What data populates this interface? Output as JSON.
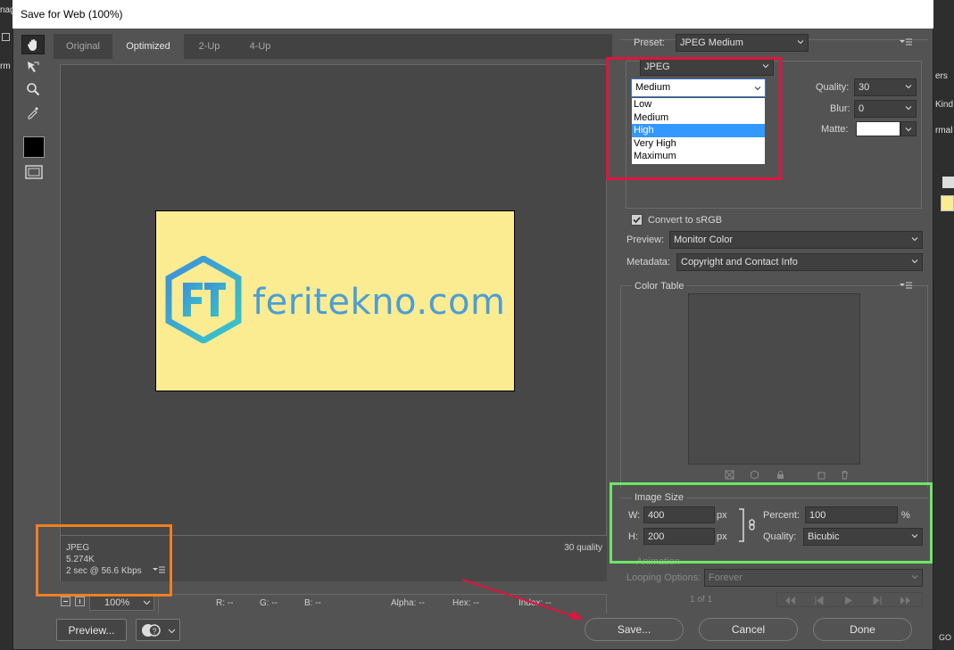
{
  "app": {
    "left_fragments": [
      "nag",
      "rm"
    ],
    "right_fragments": [
      "ers",
      "Kind",
      "rmal",
      "GO"
    ]
  },
  "dialog": {
    "title": "Save for Web (100%)"
  },
  "tabs": [
    "Original",
    "Optimized",
    "2-Up",
    "4-Up"
  ],
  "image": {
    "logo_text": "feritekno.com",
    "logo_mark": "FT"
  },
  "info": {
    "format": "JPEG",
    "size": "5.274K",
    "download": "2 sec @ 56.6 Kbps",
    "quality_note": "30 quality"
  },
  "status": {
    "zoom": "100%",
    "r": "R: --",
    "g": "G: --",
    "b": "B: --",
    "alpha": "Alpha: --",
    "hex": "Hex: --",
    "index": "Index: --"
  },
  "buttons": {
    "preview": "Preview...",
    "save": "Save...",
    "cancel": "Cancel",
    "done": "Done"
  },
  "settings": {
    "preset_label": "Preset:",
    "preset_value": "JPEG Medium",
    "format_value": "JPEG",
    "quality_level": "Medium",
    "quality_options": [
      "Low",
      "Medium",
      "High",
      "Very High",
      "Maximum"
    ],
    "highlighted_option": "High",
    "quality_label": "Quality:",
    "quality_value": "30",
    "blur_label": "Blur:",
    "blur_value": "0",
    "matte_label": "Matte:",
    "convert_label": "Convert to sRGB",
    "preview_label": "Preview:",
    "preview_value": "Monitor Color",
    "metadata_label": "Metadata:",
    "metadata_value": "Copyright and Contact Info"
  },
  "color_table": {
    "title": "Color Table"
  },
  "image_size": {
    "title": "Image Size",
    "w_label": "W:",
    "w_value": "400",
    "h_label": "H:",
    "h_value": "200",
    "unit": "px",
    "percent_label": "Percent:",
    "percent_value": "100",
    "percent_unit": "%",
    "quality_label": "Quality:",
    "quality_value": "Bicubic"
  },
  "animation": {
    "title": "Animation",
    "looping_label": "Looping Options:",
    "looping_value": "Forever",
    "frame": "1 of 1"
  },
  "colors": {
    "annotation_orange": "#f07f22",
    "annotation_red": "#e0143c",
    "annotation_green": "#6ee566",
    "image_bg": "#fbeb91",
    "logo_blue": "#4b9ed6"
  }
}
